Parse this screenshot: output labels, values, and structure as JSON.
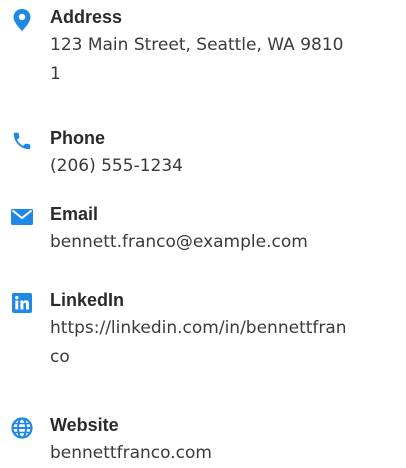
{
  "accent_color": "#1e88e5",
  "contacts": [
    {
      "icon": "map-pin-icon",
      "label": "Address",
      "value": "123 Main Street, Seattle, WA 98101"
    },
    {
      "icon": "phone-icon",
      "label": "Phone",
      "value": "(206) 555-1234"
    },
    {
      "icon": "envelope-icon",
      "label": "Email",
      "value": "bennett.franco@example.com"
    },
    {
      "icon": "linkedin-icon",
      "label": "LinkedIn",
      "value": "https://linkedin.com/in/bennettfranco"
    },
    {
      "icon": "globe-icon",
      "label": "Website",
      "value": "bennettfranco.com"
    }
  ]
}
